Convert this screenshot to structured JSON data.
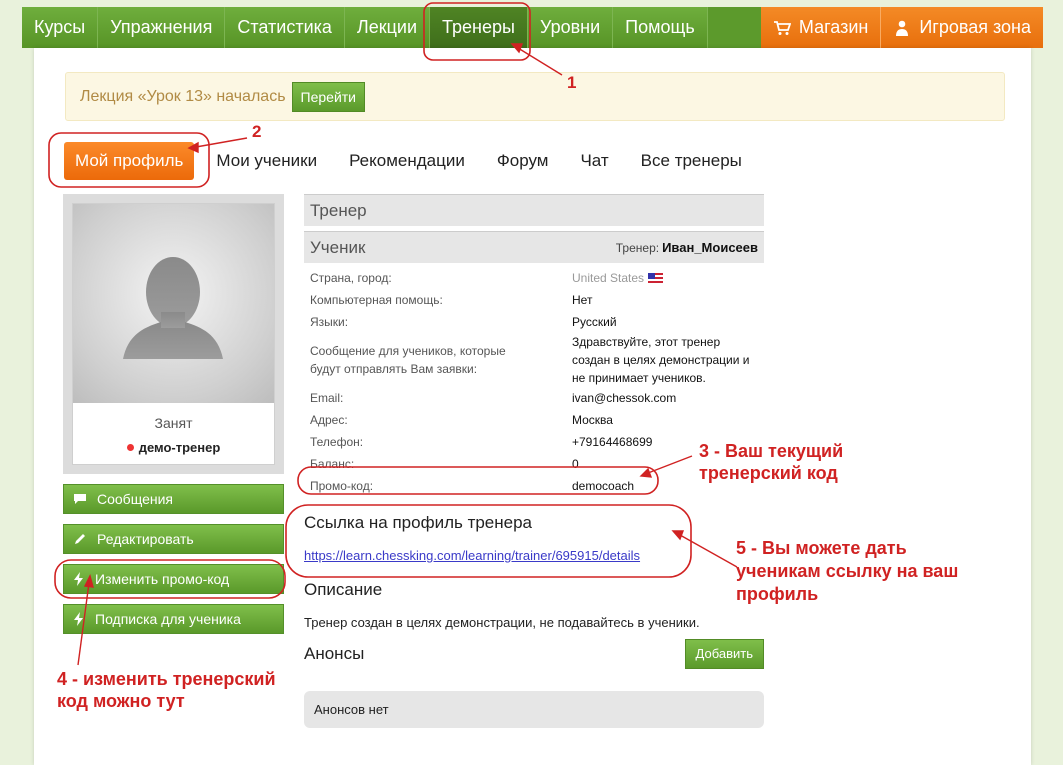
{
  "nav": {
    "items": [
      "Курсы",
      "Упражнения",
      "Статистика",
      "Лекции",
      "Тренеры",
      "Уровни",
      "Помощь"
    ],
    "active_index": 4,
    "shop": "Магазин",
    "game_zone": "Игровая зона"
  },
  "notice": {
    "text": "Лекция «Урок 13» началась",
    "button": "Перейти"
  },
  "subtabs": [
    "Мой профиль",
    "Мои ученики",
    "Рекомендации",
    "Форум",
    "Чат",
    "Все тренеры"
  ],
  "profile": {
    "status": "Занят",
    "role": "демо-тренер"
  },
  "side_buttons": {
    "messages": "Сообщения",
    "edit": "Редактировать",
    "change_promo": "Изменить промо-код",
    "subscription": "Подписка для ученика"
  },
  "main": {
    "trainer_header": "Тренер",
    "student_header": "Ученик",
    "coach_label": "Тренер:",
    "coach_name": "Иван_Моисеев",
    "rows": [
      {
        "key": "Страна, город:",
        "value": "United States"
      },
      {
        "key": "Компьютерная помощь:",
        "value": "Нет"
      },
      {
        "key": "Языки:",
        "value": "Русский"
      },
      {
        "key": "Сообщение для учеников, которые будут отправлять Вам заявки:",
        "value": "Здравствуйте, этот тренер создан в целях демонстрации и не принимает учеников."
      },
      {
        "key": "Email:",
        "value": "ivan@chessok.com"
      },
      {
        "key": "Адрес:",
        "value": "Москва"
      },
      {
        "key": "Телефон:",
        "value": "+79164468699"
      },
      {
        "key": "Баланс:",
        "value": "0"
      },
      {
        "key": "Промо-код:",
        "value": "democoach"
      }
    ],
    "profile_link_title": "Ссылка на профиль тренера",
    "profile_link": "https://learn.chessking.com/learning/trainer/695915/details",
    "description_title": "Описание",
    "description_text": "Тренер создан в целях демонстрации, не подавайтесь в ученики.",
    "announcements_title": "Анонсы",
    "add_button": "Добавить",
    "announcements_empty": "Анонсов нет"
  },
  "annotations": {
    "a1": "1",
    "a2": "2",
    "a3_line1": "3 - Ваш текущий",
    "a3_line2": "тренерский код",
    "a4_line1": "4 - изменить тренерский",
    "a4_line2": "код можно тут",
    "a5_line1": "5 - Вы можете дать",
    "a5_line2": "ученикам ссылку на ваш",
    "a5_line3": "профиль"
  },
  "colors": {
    "nav_green": "#5c9a2c",
    "accent_orange": "#f48a26",
    "annotation_red": "#d02222"
  }
}
